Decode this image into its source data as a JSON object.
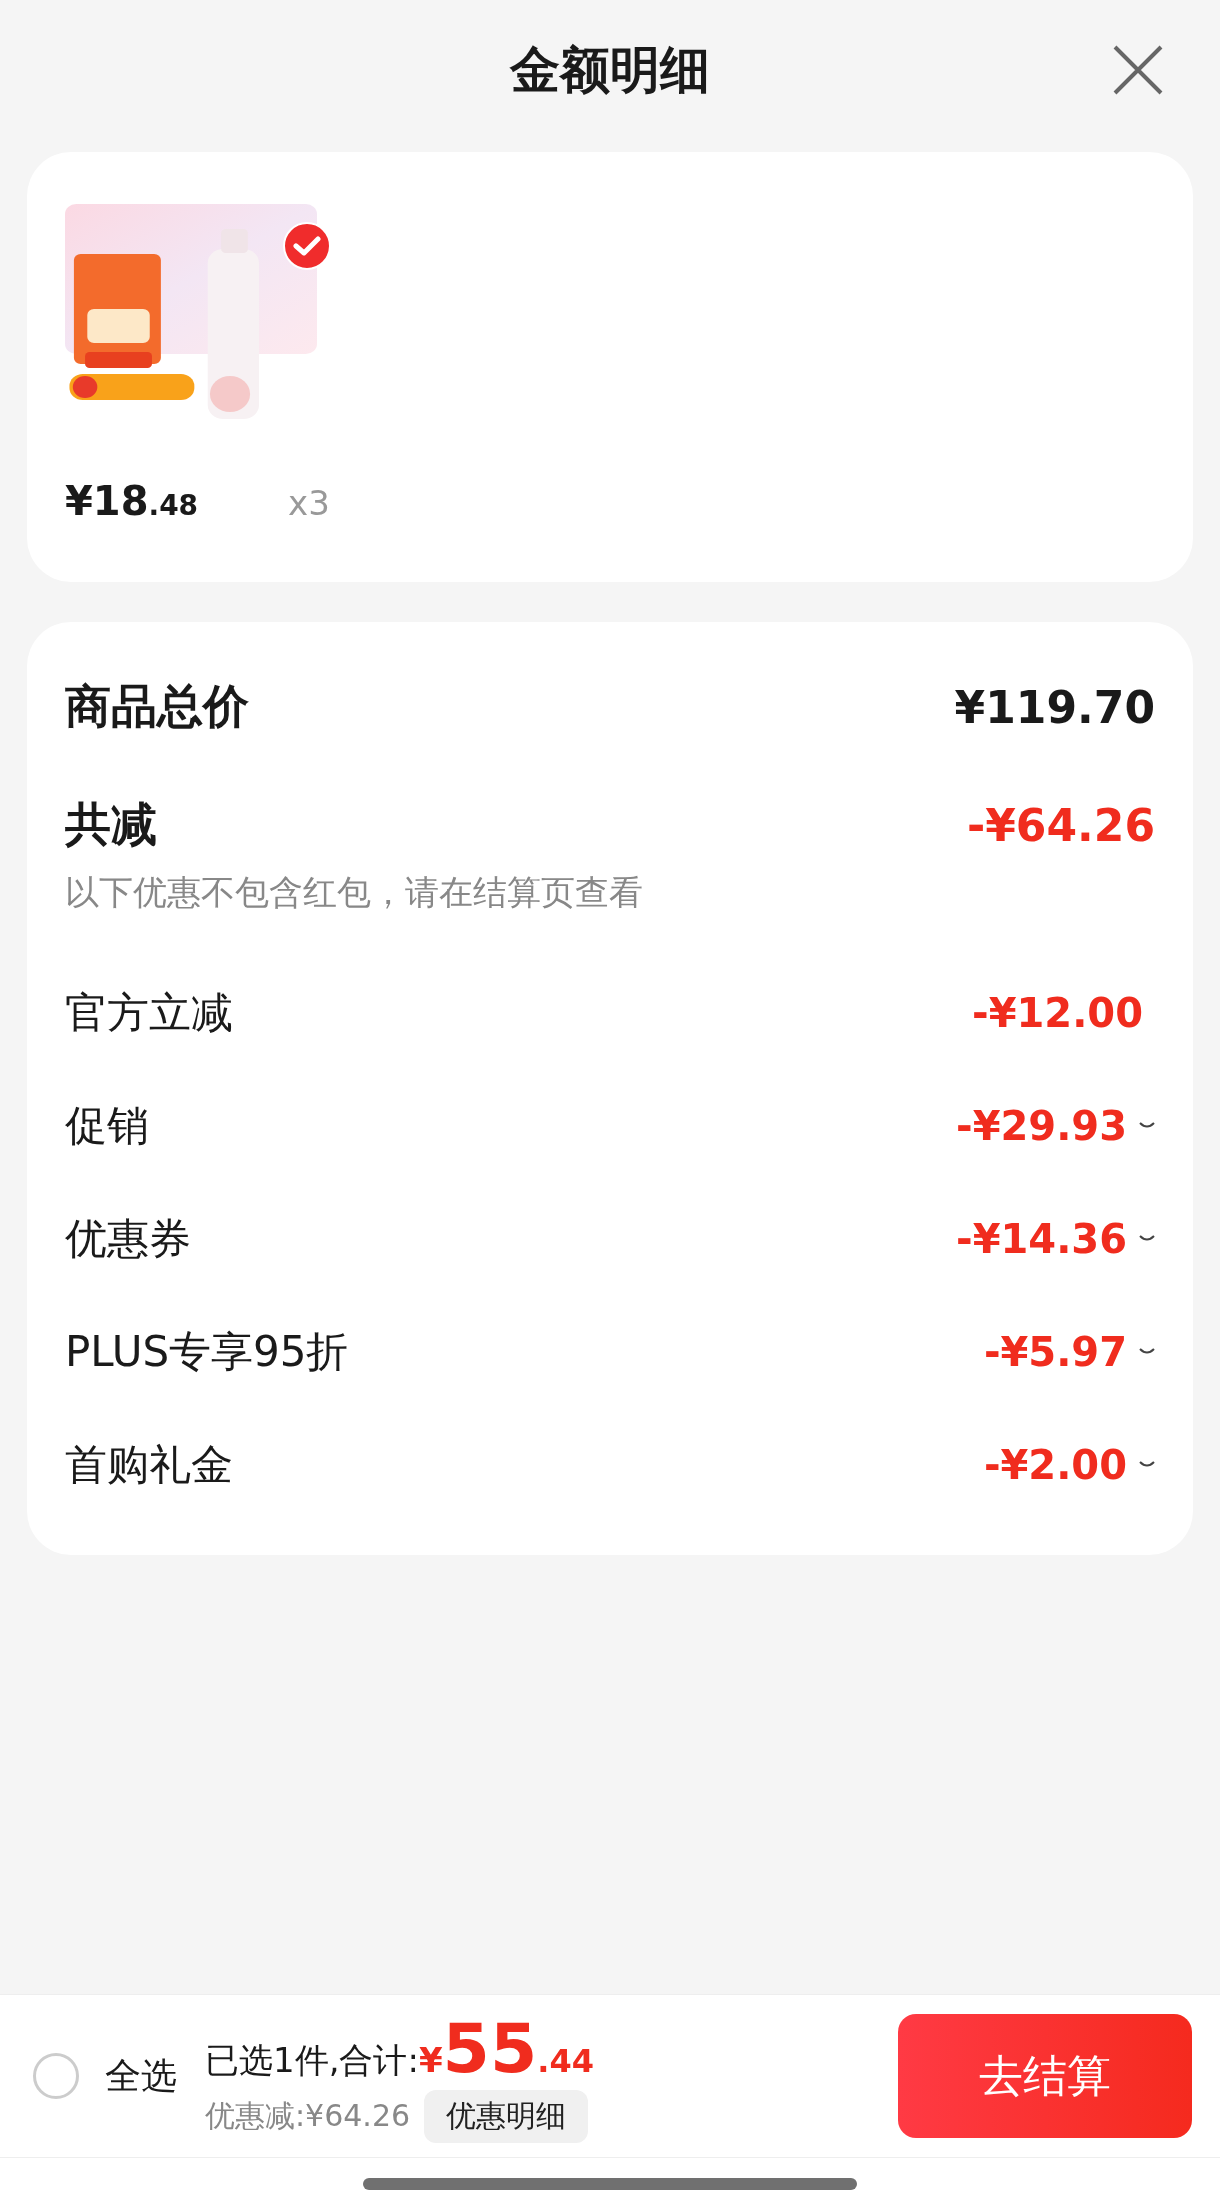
{
  "header": {
    "title": "金额明细"
  },
  "product": {
    "kind": "picture",
    "selected": true,
    "price_main": "¥18",
    "price_decimal": ".48",
    "quantity": "x3"
  },
  "summary": {
    "total_label": "商品总价",
    "total_value": "¥119.70",
    "discount_label": "共减",
    "discount_value": "-¥64.26",
    "note": "以下优惠不包含红包，请在结算页查看",
    "rows": [
      {
        "label": "官方立减",
        "value": "-¥12.00",
        "kind": "plain"
      },
      {
        "label": "促销",
        "value": "-¥29.93",
        "kind": "expandable"
      },
      {
        "label": "优惠券",
        "value": "-¥14.36",
        "kind": "expandable"
      },
      {
        "label": "PLUS专享95折",
        "value": "-¥5.97",
        "kind": "expandable"
      },
      {
        "label": "首购礼金",
        "value": "-¥2.00",
        "kind": "expandable"
      }
    ]
  },
  "bottom_bar": {
    "select_all": {
      "label": "全选",
      "checked": false
    },
    "selected_text": "已选1件,合计:",
    "currency": "¥",
    "total_main": "55",
    "total_decimal": ".44",
    "saving": "优惠减:¥64.26",
    "details_button": "优惠明细",
    "checkout_button": "去结算"
  }
}
